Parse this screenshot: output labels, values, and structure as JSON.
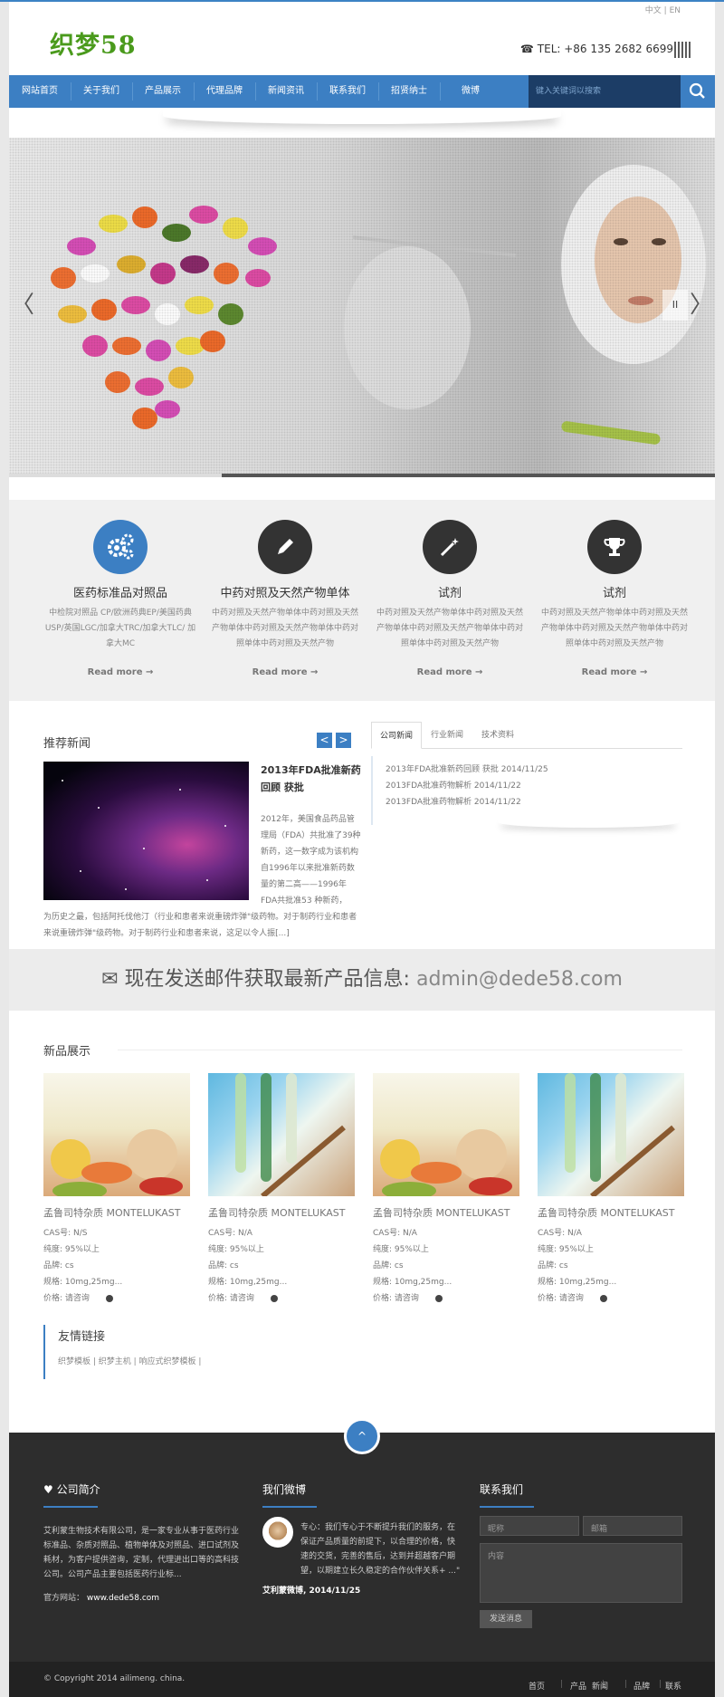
{
  "header": {
    "lang_zh": "中文",
    "lang_en": "EN",
    "logo": "织梦58",
    "tel": "TEL: +86 135 2682 6699"
  },
  "nav": {
    "items": [
      "网站首页",
      "关于我们",
      "产品展示",
      "代理品牌",
      "新闻资讯",
      "联系我们",
      "招贤纳士",
      "微博"
    ],
    "search_placeholder": "键入关键词以搜索"
  },
  "slider": {
    "prev": "〈",
    "next": "〉",
    "pause": "II"
  },
  "features": [
    {
      "title": "医药标准品对照品",
      "text": "中检院对照品 CP/欧洲药典EP/美国药典USP/英国LGC/加拿大TRC/加拿大TLC/ 加拿大MC",
      "more": "Read more →"
    },
    {
      "title": "中药对照及天然产物单体",
      "text": "中药对照及天然产物单体中药对照及天然产物单体中药对照及天然产物单体中药对照单体中药对照及天然产物",
      "more": "Read more →"
    },
    {
      "title": "试剂",
      "text": "中药对照及天然产物单体中药对照及天然产物单体中药对照及天然产物单体中药对照单体中药对照及天然产物",
      "more": "Read more →"
    },
    {
      "title": "试剂",
      "text": "中药对照及天然产物单体中药对照及天然产物单体中药对照及天然产物单体中药对照单体中药对照及天然产物",
      "more": "Read more →"
    }
  ],
  "news": {
    "title": "推荐新闻",
    "prev": "<",
    "next": ">",
    "headline": "2013年FDA批准新药回顾 获批",
    "summary_side": "2012年，美国食品药品管理局（FDA）共批准了39种新药，这一数字成为该机构自1996年以来批准新药数量的第二高——1996年FDA共批准53 种新药，",
    "summary_rest": "为历史之最，包括阿托伐他汀（行业和患者来说重磅炸弹\"级药物。对于制药行业和患者来说重磅炸弹\"级药物。对于制药行业和患者来说，这足以令人振[...]"
  },
  "tabs": {
    "labels": [
      "公司新闻",
      "行业新闻",
      "技术资料"
    ],
    "items": [
      "2013年FDA批准新药回顾 获批 2014/11/25",
      "2013FDA批准药物解析 2014/11/22",
      "2013FDA批准药物解析 2014/11/22"
    ]
  },
  "mailbar": {
    "text": "现在发送邮件获取最新产品信息:",
    "email": "admin@dede58.com"
  },
  "products": {
    "title": "新品展示",
    "items": [
      {
        "name": "孟鲁司特杂质 MONTELUKAST",
        "cas": "CAS号: N/S",
        "purity": "纯度: 95%以上",
        "brand": "品牌: cs",
        "size": "规格: 10mg,25mg...",
        "price": "价格: 请咨询"
      },
      {
        "name": "孟鲁司特杂质 MONTELUKAST",
        "cas": "CAS号: N/A",
        "purity": "纯度: 95%以上",
        "brand": "品牌: cs",
        "size": "规格: 10mg,25mg...",
        "price": "价格: 请咨询"
      },
      {
        "name": "孟鲁司特杂质 MONTELUKAST",
        "cas": "CAS号: N/A",
        "purity": "纯度: 95%以上",
        "brand": "品牌: cs",
        "size": "规格: 10mg,25mg...",
        "price": "价格: 请咨询"
      },
      {
        "name": "孟鲁司特杂质 MONTELUKAST",
        "cas": "CAS号: N/A",
        "purity": "纯度: 95%以上",
        "brand": "品牌: cs",
        "size": "规格: 10mg,25mg...",
        "price": "价格: 请咨询"
      }
    ]
  },
  "links": {
    "title": "友情链接",
    "text": "织梦模板 | 织梦主机 | 响应式织梦模板 |"
  },
  "footer": {
    "about_title": "公司简介",
    "about_text": "艾利蒙生物技术有限公司，是一家专业从事于医药行业标准品、杂质对照品、植物单体及对照品、进口试剂及耗材，为客户提供咨询，定制，代理进出口等的高科技公司。公司产品主要包括医药行业标...",
    "site_label": "官方网站：",
    "site_url": "www.dede58.com",
    "weibo_title": "我们微博",
    "weibo_text": "专心：我们专心于不断提升我们的服务，在保证产品质量的前提下，以合理的价格，快速的交货，完善的售后，达到并超越客户期望，以期建立长久稳定的合作伙伴关系+ ...\"",
    "weibo_author": "艾利蒙微博, 2014/11/25",
    "contact_title": "联系我们",
    "name_ph": "昵称",
    "email_ph": "邮箱",
    "content_ph": "内容",
    "send": "发送消息",
    "totop": "^",
    "copyright": "© Copyright 2014 ailimeng. china.",
    "bottom_links": [
      "首页",
      "产品",
      "新闻",
      "品牌",
      "联系"
    ]
  }
}
